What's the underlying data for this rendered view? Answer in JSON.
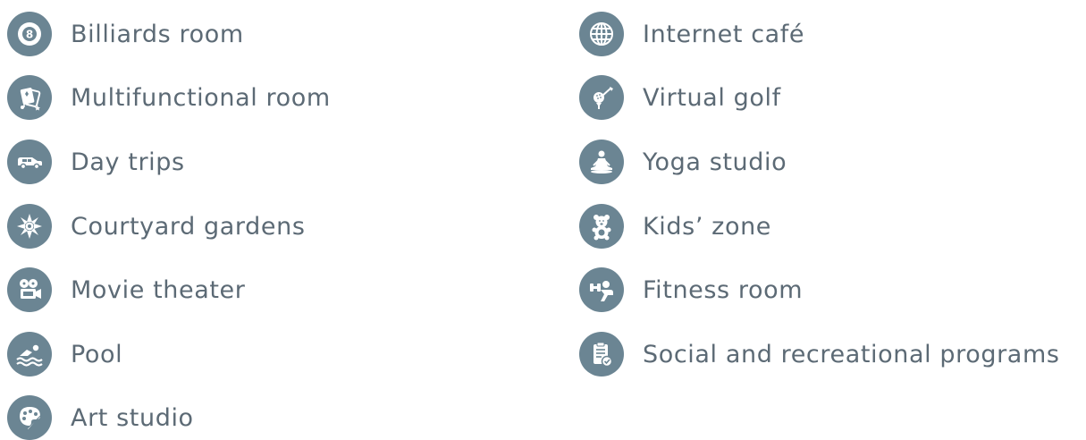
{
  "colors": {
    "icon_background": "#6b8593",
    "icon_foreground": "#ffffff",
    "text": "#5c6a75"
  },
  "amenities_left": [
    {
      "label": "Billiards room",
      "icon": "billiard-ball-icon"
    },
    {
      "label": "Multifunctional room",
      "icon": "playing-cards-music-icon"
    },
    {
      "label": "Day trips",
      "icon": "van-icon"
    },
    {
      "label": "Courtyard gardens",
      "icon": "flower-icon"
    },
    {
      "label": "Movie theater",
      "icon": "film-projector-icon"
    },
    {
      "label": "Pool",
      "icon": "swimmer-icon"
    },
    {
      "label": "Art studio",
      "icon": "paint-palette-icon"
    }
  ],
  "amenities_right": [
    {
      "label": "Internet café",
      "icon": "globe-icon"
    },
    {
      "label": "Virtual golf",
      "icon": "golf-ball-tee-icon"
    },
    {
      "label": "Yoga studio",
      "icon": "yoga-pose-icon"
    },
    {
      "label": "Kids’ zone",
      "icon": "teddy-bear-icon"
    },
    {
      "label": "Fitness room",
      "icon": "dumbbell-person-icon"
    },
    {
      "label": "Social and recreational programs",
      "icon": "clipboard-check-icon"
    }
  ]
}
